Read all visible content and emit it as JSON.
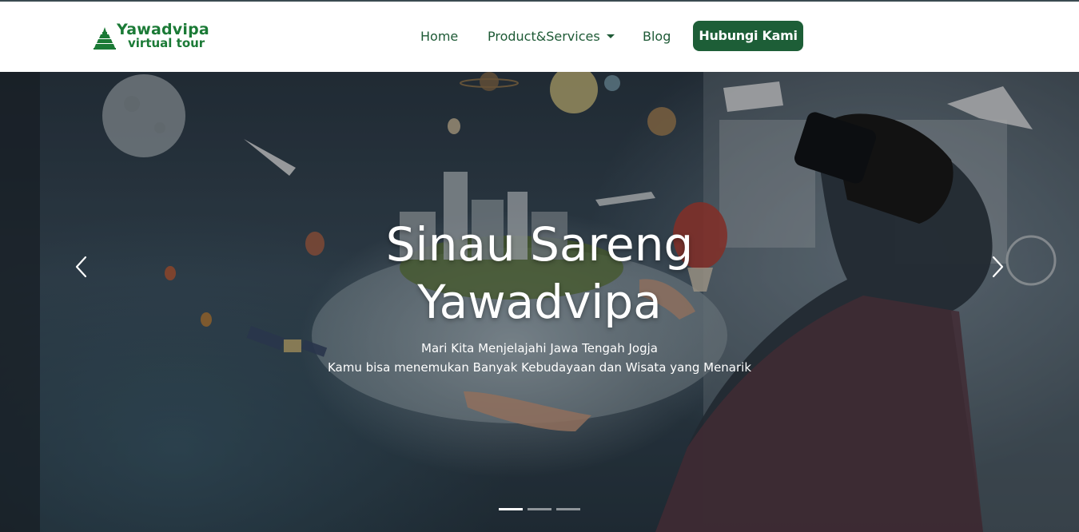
{
  "brand": {
    "name_line1": "Yawadvipa",
    "name_line2": "virtual tour",
    "icon": "temple-icon",
    "color": "#1b7a36"
  },
  "nav": {
    "items": [
      {
        "label": "Home"
      },
      {
        "label": "Product&Services",
        "has_dropdown": true
      },
      {
        "label": "Blog"
      }
    ],
    "cta_label": "Hubungi Kami",
    "cta_color": "#1d5e37"
  },
  "hero": {
    "title_line1": "Sinau Sareng",
    "title_line2": "Yawadvipa",
    "subtitle_line1": "Mari Kita Menjelajahi Jawa Tengah Jogja",
    "subtitle_line2": "Kamu bisa menemukan Banyak Kebudayaan dan Wisata yang Menarik",
    "prev_icon": "chevron-left-icon",
    "next_icon": "chevron-right-icon",
    "slide_count": 3,
    "active_slide": 1
  }
}
